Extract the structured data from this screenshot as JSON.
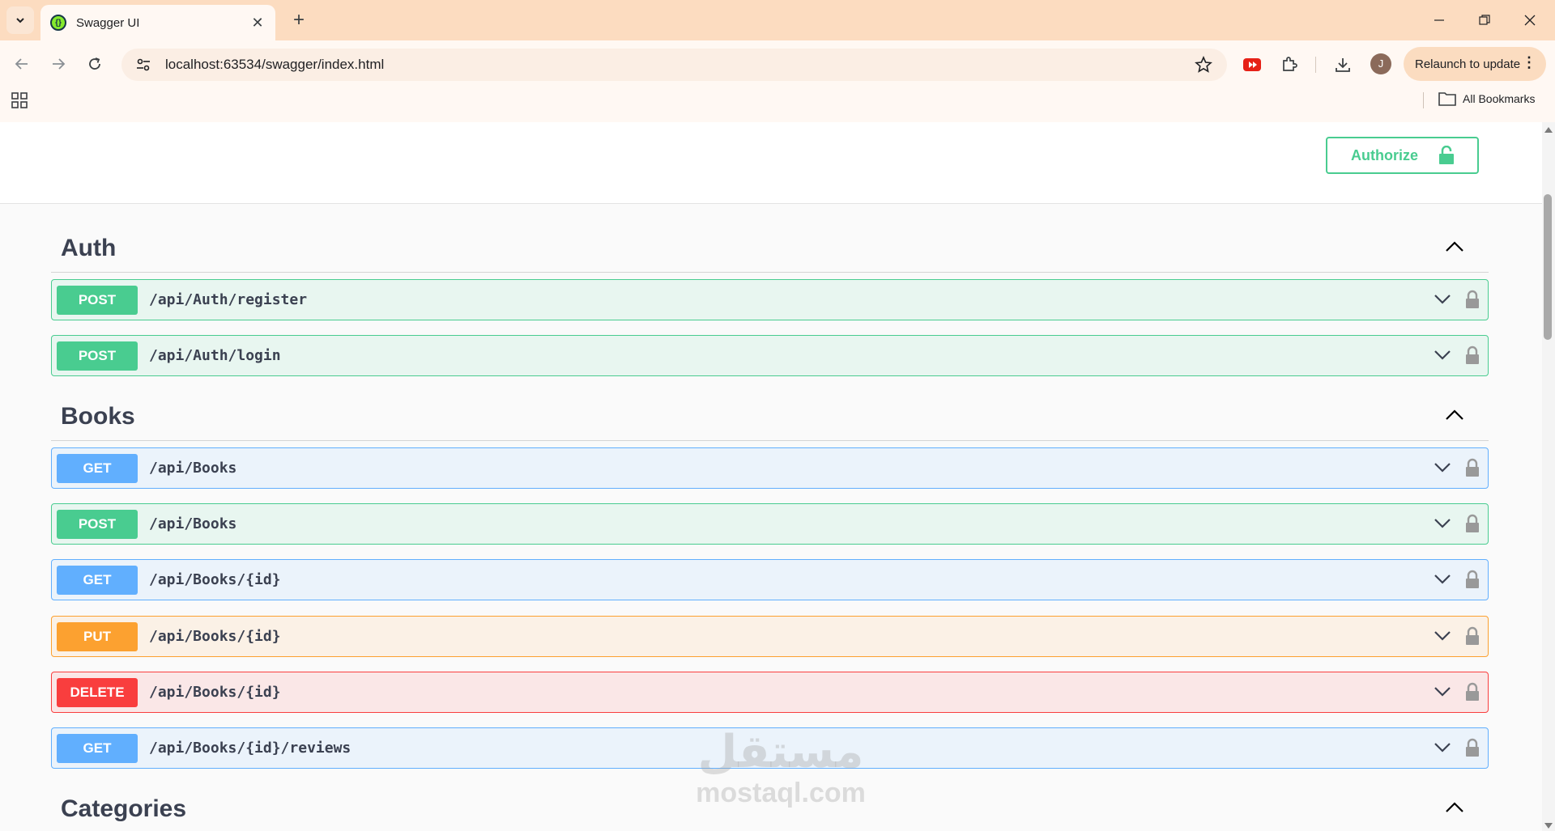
{
  "browser": {
    "tab_title": "Swagger UI",
    "url": "localhost:63534/swagger/index.html",
    "profile_initial": "J",
    "relaunch_label": "Relaunch to update",
    "bookmarks_label": "All Bookmarks"
  },
  "topbar": {
    "authorize_label": "Authorize"
  },
  "sections": {
    "auth": {
      "title": "Auth",
      "ops": [
        {
          "method": "POST",
          "path": "/api/Auth/register"
        },
        {
          "method": "POST",
          "path": "/api/Auth/login"
        }
      ]
    },
    "books": {
      "title": "Books",
      "ops": [
        {
          "method": "GET",
          "path": "/api/Books"
        },
        {
          "method": "POST",
          "path": "/api/Books"
        },
        {
          "method": "GET",
          "path": "/api/Books/{id}"
        },
        {
          "method": "PUT",
          "path": "/api/Books/{id}"
        },
        {
          "method": "DELETE",
          "path": "/api/Books/{id}"
        },
        {
          "method": "GET",
          "path": "/api/Books/{id}/reviews"
        }
      ]
    },
    "categories": {
      "title": "Categories"
    }
  },
  "watermark": {
    "arabic": "مستقل",
    "latin": "mostaql.com"
  },
  "colors": {
    "post": "#49cc90",
    "get": "#61affe",
    "put": "#fca130",
    "delete": "#f93e3e"
  }
}
